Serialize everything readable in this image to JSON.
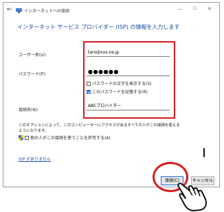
{
  "window": {
    "title": "インターネットへの接続",
    "minimize_glyph": "—",
    "maximize_glyph": "☐",
    "close_glyph": "✕",
    "back_glyph": "←"
  },
  "heading": "インターネット サービス プロバイダー (ISP) の情報を入力します",
  "form": {
    "username_label": "ユーザー名(U):",
    "username_value": "taro@xxx.ne.jp",
    "password_label": "パスワード(P):",
    "password_value": "●●●●●●",
    "show_password_label": "パスワードの文字を表示する(S)",
    "show_password_checked": false,
    "remember_password_label": "このパスワードを記憶する(R)",
    "remember_password_checked": true,
    "connection_name_label": "接続名(N):",
    "connection_name_value": "ABCプロバイダー"
  },
  "note": "このオプションによって、このコンピューターにアクセスがあるすべての人がこの接続を使えるようになります。",
  "allow_others_label": "他の人がこの接続を使うことを許可する(A)",
  "allow_others_checked": false,
  "isp_link": "ISP がありません",
  "buttons": {
    "connect": "接続(C)",
    "cancel": "キャンセル"
  },
  "colors": {
    "accent": "#1f6fd6",
    "highlight_red": "#d71920",
    "link": "#1a4fa0"
  },
  "icons": [
    "back-arrow-icon",
    "network-icon",
    "shield-icon",
    "pointing-hand-icon"
  ]
}
